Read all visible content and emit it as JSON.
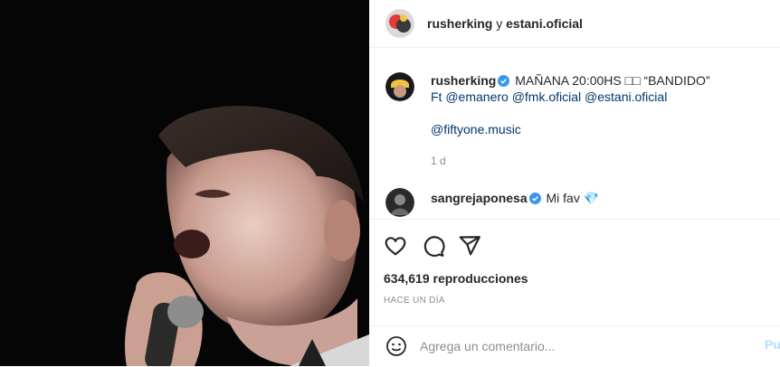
{
  "media": {
    "alt": "video frame of singer with microphone"
  },
  "header": {
    "author": "rusherking",
    "connector": " y ",
    "coauthor": "estani.oficial"
  },
  "caption": {
    "username": "rusherking",
    "text": " MAÑANA 20:00HS □□ “BANDIDO”",
    "ft_prefix": "Ft ",
    "mention1": "@emanero",
    "mention2": "@fmk.oficial",
    "mention3": "@estani.oficial",
    "mention4": "@fiftyone.music",
    "time": "1 d"
  },
  "comments": [
    {
      "username": "sangrejaponesa",
      "text": " Mi fav 💎"
    }
  ],
  "stats": {
    "views": "634,619 reproducciones",
    "posted": "HACE UN DÍA"
  },
  "add_comment": {
    "placeholder": "Agrega un comentario...",
    "post_label": "Publicar"
  },
  "colors": {
    "verified": "#3897f0",
    "link": "#00376b",
    "muted": "#8e8e8e"
  }
}
